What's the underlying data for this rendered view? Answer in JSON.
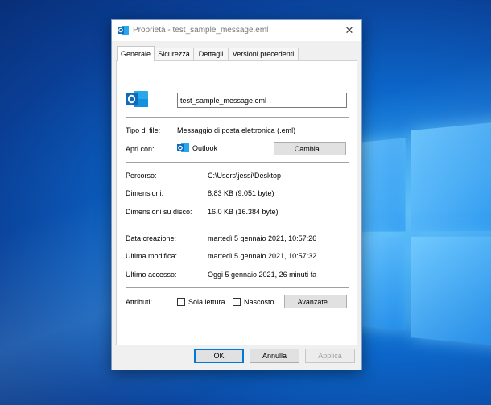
{
  "window": {
    "title": "Proprietà - test_sample_message.eml",
    "close_label": "✕"
  },
  "tabs": [
    {
      "label": "Generale",
      "active": true
    },
    {
      "label": "Sicurezza"
    },
    {
      "label": "Dettagli"
    },
    {
      "label": "Versioni precedenti"
    }
  ],
  "general": {
    "file_name": "test_sample_message.eml",
    "file_type_label": "Tipo di file:",
    "file_type_value": "Messaggio di posta elettronica (.eml)",
    "opens_with_label": "Apri con:",
    "opens_with_value": "Outlook",
    "change_button": "Cambia...",
    "location_label": "Percorso:",
    "location_value": "C:\\Users\\jessi\\Desktop",
    "size_label": "Dimensioni:",
    "size_value": "8,83 KB (9.051 byte)",
    "size_on_disk_label": "Dimensioni su disco:",
    "size_on_disk_value": "16,0 KB (16.384 byte)",
    "created_label": "Data creazione:",
    "created_value": "martedì 5 gennaio 2021, 10:57:26",
    "modified_label": "Ultima modifica:",
    "modified_value": "martedì 5 gennaio 2021, 10:57:32",
    "accessed_label": "Ultimo accesso:",
    "accessed_value": "Oggi 5 gennaio 2021, 26 minuti fa",
    "attributes_label": "Attributi:",
    "readonly_label": "Sola lettura",
    "hidden_label": "Nascosto",
    "advanced_button": "Avanzate..."
  },
  "footer": {
    "ok": "OK",
    "cancel": "Annulla",
    "apply": "Applica"
  },
  "colors": {
    "outlook_blue": "#0f6cbd",
    "accent": "#0078d7",
    "desktop": "#0c66c9"
  }
}
